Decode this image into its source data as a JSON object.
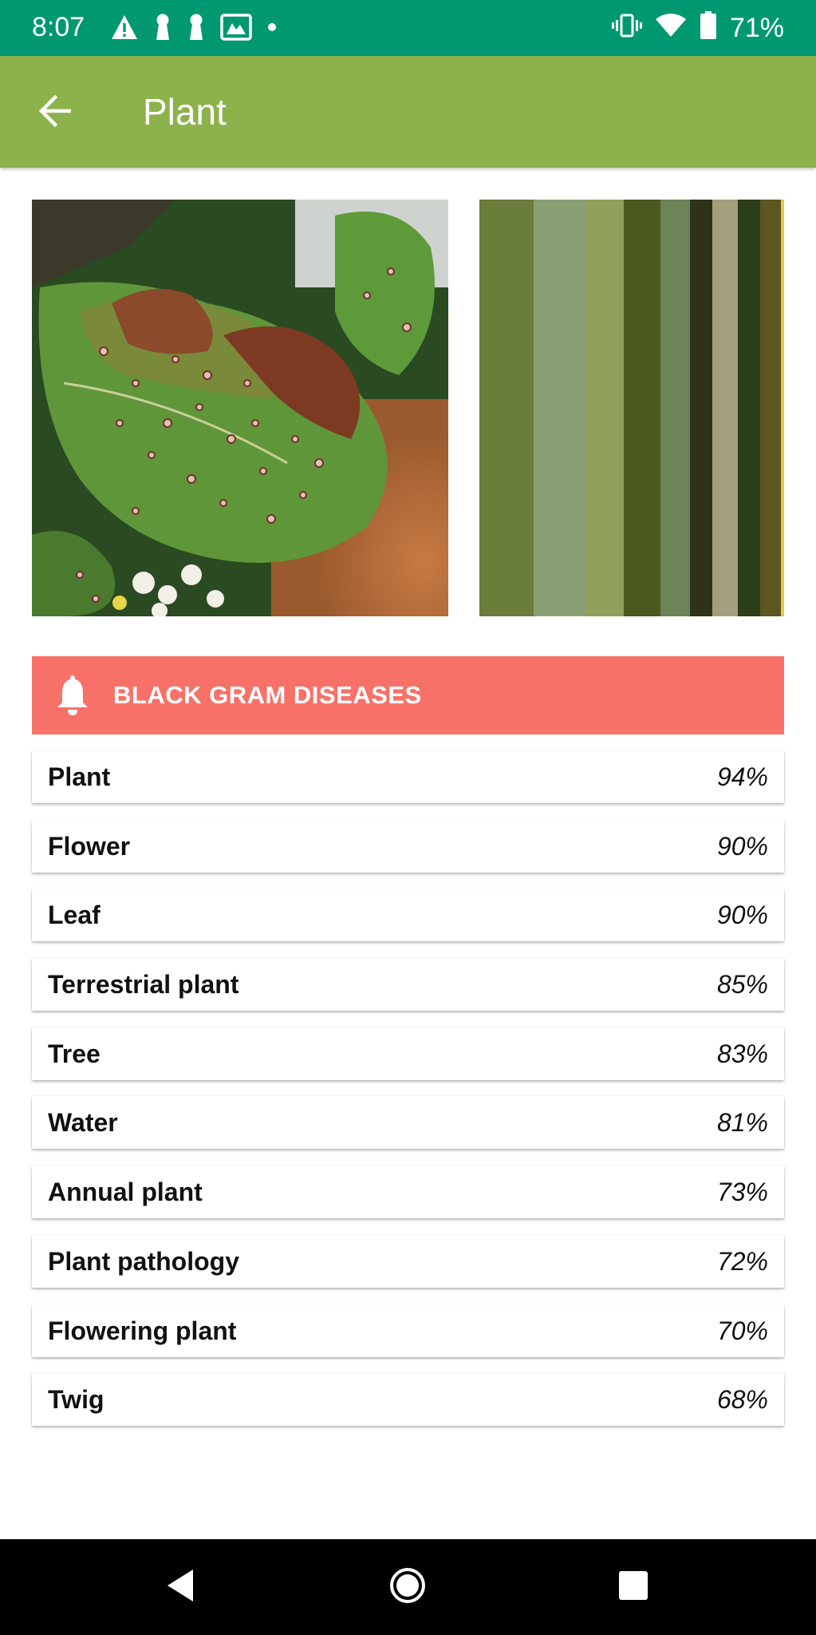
{
  "status_bar": {
    "time": "8:07",
    "left_icons": [
      "warning-icon",
      "keyhole-icon",
      "keyhole-icon",
      "gallery-icon",
      "dot-icon"
    ],
    "right_icons": [
      "vibrate-icon",
      "wifi-icon",
      "battery-icon"
    ],
    "battery": "71%"
  },
  "app_bar": {
    "back_icon": "arrow-back-icon",
    "title": "Plant"
  },
  "image": {
    "description_icon": "leaf-photo"
  },
  "palette": {
    "colors": [
      "#6b7d3a",
      "#8b9f74",
      "#8ea05a",
      "#4a5a1e",
      "#6d8358",
      "#2e3318",
      "#a39e7e",
      "#2c3d1a",
      "#5e5520",
      "#e8c84a"
    ]
  },
  "banner": {
    "icon": "bell-icon",
    "title": "BLACK GRAM DISEASES",
    "color": "#f87168"
  },
  "labels": [
    {
      "name": "Plant",
      "score": "94%"
    },
    {
      "name": "Flower",
      "score": "90%"
    },
    {
      "name": "Leaf",
      "score": "90%"
    },
    {
      "name": "Terrestrial plant",
      "score": "85%"
    },
    {
      "name": "Tree",
      "score": "83%"
    },
    {
      "name": "Water",
      "score": "81%"
    },
    {
      "name": "Annual plant",
      "score": "73%"
    },
    {
      "name": "Plant pathology",
      "score": "72%"
    },
    {
      "name": "Flowering plant",
      "score": "70%"
    },
    {
      "name": "Twig",
      "score": "68%"
    }
  ],
  "nav_bar": {
    "icons": [
      "back-triangle-icon",
      "home-circle-icon",
      "recents-square-icon"
    ]
  },
  "colors": {
    "status_bar": "#009870",
    "app_bar": "#8bb24b",
    "banner": "#f87168"
  }
}
